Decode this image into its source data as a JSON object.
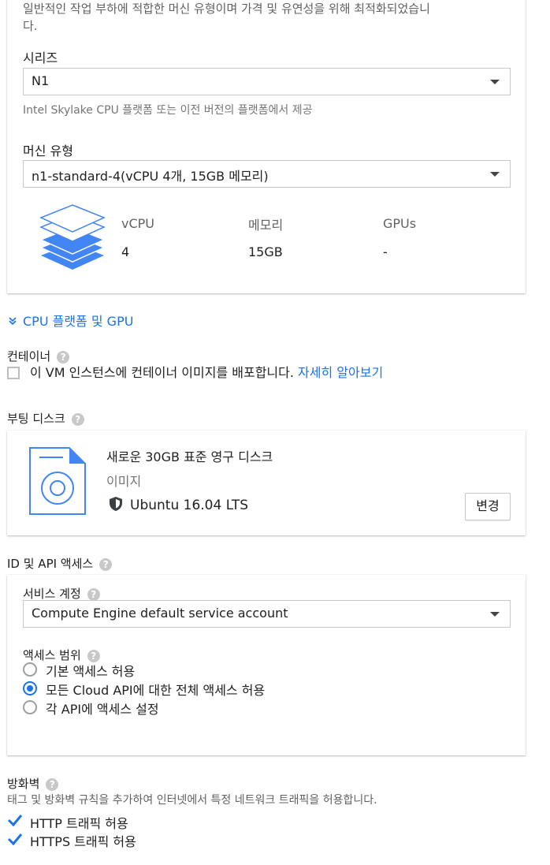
{
  "machine": {
    "description_line1": "일반적인 작업 부하에 적합한 머신 유형이며 가격 및 유연성을 위해 최적화되었습니",
    "description_line2": "다.",
    "series_label": "시리즈",
    "series_value": "N1",
    "series_hint": "Intel Skylake CPU 플랫폼 또는 이전 버전의 플랫폼에서 제공",
    "type_label": "머신 유형",
    "type_value": "n1-standard-4(vCPU 4개, 15GB 메모리)",
    "specs": {
      "vcpu_header": "vCPU",
      "vcpu_value": "4",
      "memory_header": "메모리",
      "memory_value": "15GB",
      "gpu_header": "GPUs",
      "gpu_value": "-"
    },
    "cpu_gpu_toggle": "CPU 플랫폼 및 GPU"
  },
  "container": {
    "title": "컨테이너",
    "checkbox_label": "이 VM 인스턴스에 컨테이너 이미지를 배포합니다.",
    "learn_more": "자세히 알아보기",
    "checked": false
  },
  "boot_disk": {
    "title": "부팅 디스크",
    "disk_name": "새로운 30GB 표준 영구 디스크",
    "image_label": "이미지",
    "image_value": "Ubuntu 16.04 LTS",
    "change_button": "변경"
  },
  "access": {
    "title": "ID 및 API 액세스",
    "service_account_label": "서비스 계정",
    "service_account_value": "Compute Engine default service account",
    "scope_label": "액세스 범위",
    "options": [
      {
        "label": "기본 액세스 허용",
        "selected": false
      },
      {
        "label": "모든 Cloud API에 대한 전체 액세스 허용",
        "selected": true
      },
      {
        "label": "각 API에 액세스 설정",
        "selected": false
      }
    ]
  },
  "firewall": {
    "title": "방화벽",
    "description": "태그 및 방화벽 규칙을 추가하여 인터넷에서 특정 네트워크 트래픽을 허용합니다.",
    "http_label": "HTTP 트래픽 허용",
    "https_label": "HTTPS 트래픽 허용",
    "http_checked": true,
    "https_checked": true
  },
  "colors": {
    "accent": "#1a73e8",
    "stack_icon": "#4285f4",
    "text": "#212121"
  },
  "help_glyph": "?"
}
